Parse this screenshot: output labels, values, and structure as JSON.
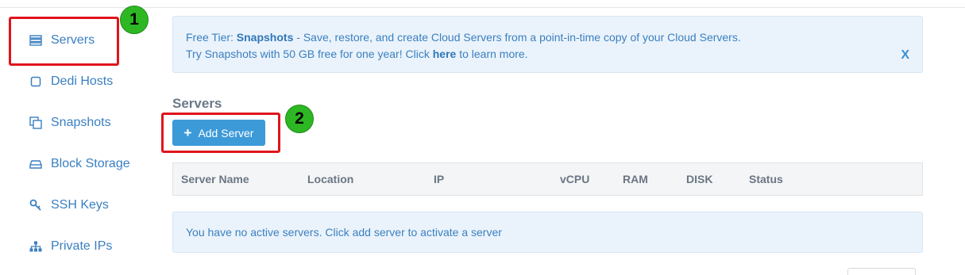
{
  "sidebar": {
    "items": [
      {
        "label": "Servers",
        "icon": "server-icon"
      },
      {
        "label": "Dedi Hosts",
        "icon": "square-icon"
      },
      {
        "label": "Snapshots",
        "icon": "copy-icon"
      },
      {
        "label": "Block Storage",
        "icon": "drive-icon"
      },
      {
        "label": "SSH Keys",
        "icon": "key-icon"
      },
      {
        "label": "Private IPs",
        "icon": "network-icon"
      }
    ]
  },
  "annotations": {
    "badge1": "1",
    "badge2": "2"
  },
  "alert": {
    "prefix": "Free Tier: ",
    "bold": "Snapshots",
    "line1_rest": " - Save, restore, and create Cloud Servers from a point-in-time copy of your Cloud Servers.",
    "line2_start": "Try Snapshots with 50 GB free for one year! Click ",
    "link": "here",
    "line2_end": " to learn more.",
    "close": "X"
  },
  "main": {
    "title": "Servers",
    "add_button": "Add Server",
    "add_icon": "+",
    "columns": [
      "Server Name",
      "Location",
      "IP",
      "vCPU",
      "RAM",
      "DISK",
      "Status"
    ],
    "empty_message": "You have no active servers. Click add server to activate a server"
  },
  "colors": {
    "accent": "#3d9ad8",
    "link": "#3a7fc1",
    "highlight": "#e0141c",
    "badge": "#2db823"
  }
}
